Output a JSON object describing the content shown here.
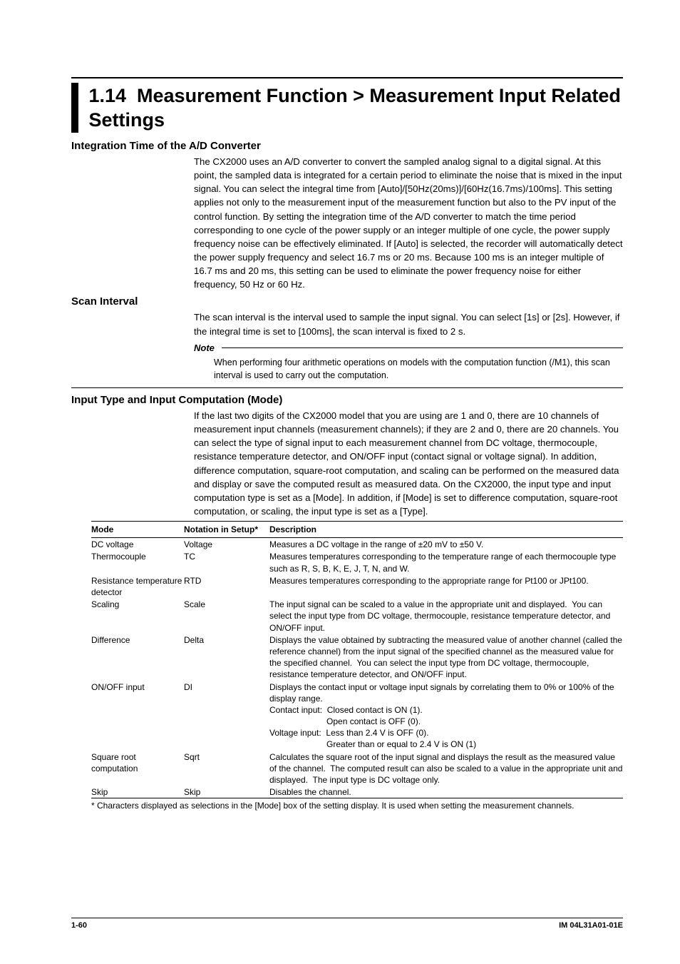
{
  "title": {
    "num": "1.14",
    "text": "Measurement Function > Measurement Input Related Settings"
  },
  "s1": {
    "head": "Integration Time of the A/D Converter",
    "body": "The CX2000 uses an A/D converter to convert the sampled analog signal to a digital signal.  At this point, the sampled data is integrated for a certain period to eliminate the noise that is mixed in the input signal.  You can select the integral time from [Auto]/[50Hz(20ms)]/[60Hz(16.7ms)/100ms].  This setting applies not only to the measurement input of the measurement function but also to the PV input of the control function.  By setting the integration time of the A/D converter to match the time period corresponding to one cycle of the power supply or an integer multiple of one cycle, the power supply frequency noise can be effectively eliminated.  If [Auto] is selected, the recorder will automatically detect the power supply frequency and select 16.7 ms or 20 ms.  Because 100 ms is an integer multiple of 16.7 ms and 20 ms, this setting can be used to eliminate the power frequency noise for either frequency, 50 Hz or 60 Hz."
  },
  "s2": {
    "head": "Scan Interval",
    "body": "The scan interval is the interval used to sample the input signal.  You can select [1s] or [2s].  However, if the integral time is set to [100ms], the scan interval is fixed to 2 s.",
    "note_label": "Note",
    "note_body": "When performing four arithmetic operations on models with the computation function (/M1), this scan interval is used to carry out the computation."
  },
  "s3": {
    "head": "Input Type and Input Computation (Mode)",
    "body": "If the last two digits of the CX2000 model that you are using are 1 and 0, there are 10 channels of measurement input channels (measurement channels); if they are 2 and 0, there are 20 channels.  You can select the type of signal input to each measurement channel from DC voltage, thermocouple, resistance temperature detector, and ON/OFF input (contact signal or voltage signal).  In addition, difference computation, square-root computation, and scaling can be performed on the measured data and display or save the computed result as measured data.  On the CX2000, the input type and input computation type is set as a [Mode].  In addition, if [Mode] is set to difference computation, square-root computation, or scaling, the input type is set as a [Type]."
  },
  "table": {
    "h1": "Mode",
    "h2": "Notation in Setup*",
    "h3": "Description",
    "rows": [
      {
        "c1": "DC voltage",
        "c2": "Voltage",
        "c3": "Measures a DC voltage in the range of ±20 mV to ±50 V."
      },
      {
        "c1": "Thermocouple",
        "c2": "TC",
        "c3": "Measures temperatures corresponding to the temperature range of each thermocouple type such as R, S, B, K, E, J, T, N, and W."
      },
      {
        "c1": "Resistance temperature detector",
        "c2": "RTD",
        "c3": "Measures temperatures corresponding to the appropriate range for Pt100 or JPt100."
      },
      {
        "c1": "Scaling",
        "c2": "Scale",
        "c3": "The input signal can be scaled to a value in the appropriate unit and displayed.  You can select the input type from DC voltage, thermocouple, resistance temperature detector, and ON/OFF input."
      },
      {
        "c1": "Difference",
        "c2": "Delta",
        "c3": "Displays the value obtained by subtracting the measured value of another channel (called the reference channel) from the input signal of the specified channel as the measured value for the specified channel.  You can select the input type from DC voltage, thermocouple, resistance temperature detector, and ON/OFF input."
      },
      {
        "c1": "ON/OFF input",
        "c2": "DI",
        "c3": "Displays the contact input or voltage input signals by correlating them to 0% or 100% of the display range.\nContact input:  Closed contact is ON (1).\n                        Open contact is OFF (0).\nVoltage input:  Less than 2.4 V is OFF (0).\n                        Greater than or equal to 2.4 V is ON (1)"
      },
      {
        "c1": "Square root computation",
        "c2": "Sqrt",
        "c3": "Calculates the square root of the input signal and displays the result as the measured value of the channel.  The computed result can also be scaled to a value in the appropriate unit and displayed.  The input type is DC voltage only."
      },
      {
        "c1": "Skip",
        "c2": "Skip",
        "c3": "Disables the channel."
      }
    ],
    "footnote": "*  Characters displayed as selections in the [Mode] box of the setting display.  It is used when setting the measurement channels."
  },
  "footer": {
    "left": "1-60",
    "right": "IM 04L31A01-01E"
  }
}
